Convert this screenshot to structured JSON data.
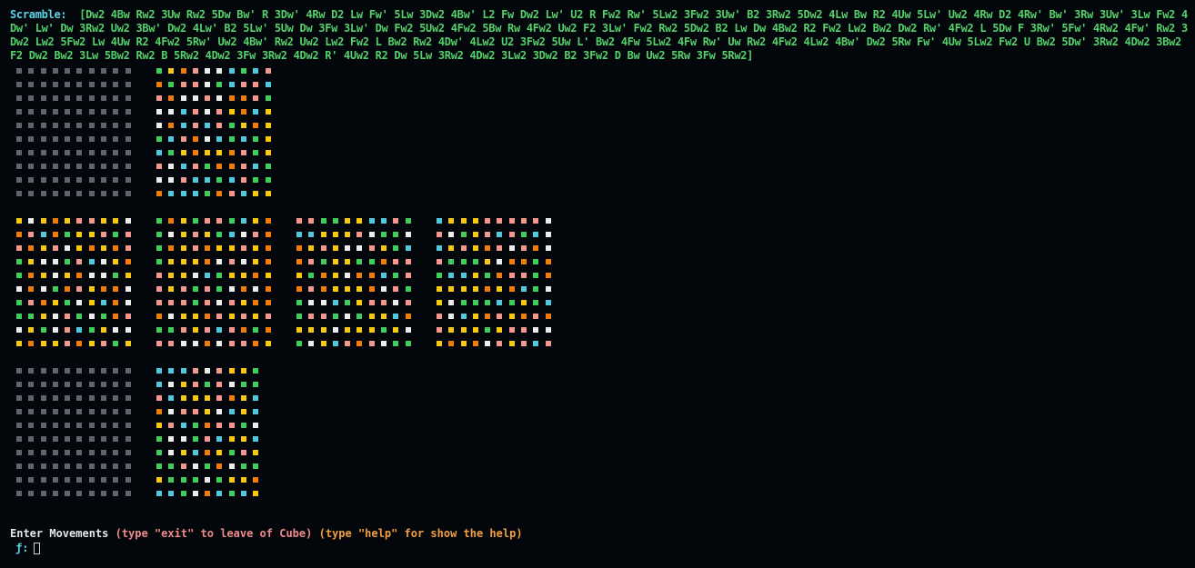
{
  "scramble": {
    "label": "Scramble:",
    "moves": "[Dw2 4Bw Rw2 3Uw Rw2 5Dw Bw' R 3Dw' 4Rw D2 Lw Fw' 5Lw 3Dw2 4Bw' L2 Fw Dw2 Lw' U2 R Fw2 Rw' 5Lw2 3Fw2 3Uw' B2 3Rw2 5Dw2 4Lw Bw R2 4Uw 5Lw' Uw2 4Rw D2 4Rw' Bw' 3Rw 3Uw' 3Lw Fw2 4Dw' Lw' Dw 3Rw2 Uw2 3Bw' Dw2 4Lw' B2 5Lw' 5Uw Dw 3Fw 3Lw' Dw Fw2 5Uw2 4Fw2 5Bw Rw 4Fw2 Uw2 F2 3Lw' Fw2 Rw2 5Dw2 B2 Lw Dw 4Bw2 R2 Fw2 Lw2 Bw2 Dw2 Rw' 4Fw2 L 5Dw F 3Rw' 5Fw' 4Rw2 4Fw' Rw2 3Dw2 Lw2 5Fw2 Lw 4Uw R2 4Fw2 5Rw' Uw2 4Bw' Rw2 Uw2 Lw2 Fw2 L Bw2 Rw2 4Dw' 4Lw2 U2 3Fw2 5Uw L' Bw2 4Fw 5Lw2 4Fw Rw' Uw Rw2 4Fw2 4Lw2 4Bw' Dw2 5Rw Fw' 4Uw 5Lw2 Fw2 U Bw2 5Dw' 3Rw2 4Dw2 3Bw2 F2 Dw2 Bw2 3Lw 5Bw2 Rw2 B 5Rw2 4Dw2 3Fw 3Rw2 4Dw2 R' 4Uw2 R2 Dw 5Lw 3Rw2 4Dw2 3Lw2 3Dw2 B2 3Fw2 D Bw Uw2 5Rw 3Fw 5Rw2]"
  },
  "colors": {
    "w": "#ececec",
    "y": "#f6c90e",
    "o": "#f07d0a",
    "r": "#f4978e",
    "g": "#3fcd5c",
    "b": "#52c8dc",
    "x": "#5f646d"
  },
  "faces": [
    {
      "name": "blank-top-left",
      "rows": [
        "xxxxxxxxxx",
        "xxxxxxxxxx",
        "xxxxxxxxxx",
        "xxxxxxxxxx",
        "xxxxxxxxxx",
        "xxxxxxxxxx",
        "xxxxxxxxxx",
        "xxxxxxxxxx",
        "xxxxxxxxxx",
        "xxxxxxxxxx"
      ]
    },
    {
      "name": "up",
      "rows": [
        "gyorwwbgbr",
        "ogrrwgbrrb",
        "rowwrwoorg",
        "wwbrwryoby",
        "wobrbrgyoy",
        "gbrowbgbgy",
        "bgyoyyorgy",
        "rwbrgoorbg",
        "wwrbbgbrgg",
        "obbbgorbyy"
      ]
    },
    {
      "name": "left",
      "rows": [
        "ywyoyrryyw",
        "orbogyyrgr",
        "royrwyoyor",
        "gywwgrbwyo",
        "goywyowwgy",
        "wowgoryoow",
        "groygwybow",
        "ggywrgwgor",
        "wygwrbgyww",
        "yoyyroyrgy"
      ]
    },
    {
      "name": "front",
      "rows": [
        "goygrrgbyo",
        "gwyrygbwro",
        "goyroyyryo",
        "gyyyowrwyo",
        "ryywbgyyoy",
        "ryrgrgwowo",
        "rrrgrwryoo",
        "owyyoryryr",
        "ggryrbrogo",
        "rrwwowrroy"
      ]
    },
    {
      "name": "right",
      "rows": [
        "rrggyybbrg",
        "bbyyyrwggw",
        "oyrywwrygb",
        "orgyyggorr",
        "ygoywoobgr",
        "oroyyyowrg",
        "gwwbgyrrwr",
        "grrgwgyybo",
        "yyywyyygyw",
        "gwybrorwgg"
      ]
    },
    {
      "name": "back",
      "rows": [
        "byyyrrrrrw",
        "rwgyrbrgbw",
        "byryorwrow",
        "rgggywoogo",
        "gbbygorrgo",
        "yyyyoyobgw",
        "ywgggbgygb",
        "rwbyoryoro",
        "ryyygyrrww",
        "yoyowryrbr"
      ]
    },
    {
      "name": "blank-bottom-left",
      "rows": [
        "xxxxxxxxxx",
        "xxxxxxxxxx",
        "xxxxxxxxxx",
        "xxxxxxxxxx",
        "xxxxxxxxxx",
        "xxxxxxxxxx",
        "xxxxxxxxxx",
        "xxxxxxxxxx",
        "xxxxxxxxxx",
        "xxxxxxxxxx"
      ]
    },
    {
      "name": "down",
      "rows": [
        "bbbrwryyg",
        "bwyrgrwgg",
        "rbyyyroyb",
        "owrrywbyb",
        "yrbgorrgw",
        "gwwgrbyyb",
        "gwyboygry",
        "ggrwgowgg",
        "ygggwgyyo",
        "bbgwobgby"
      ]
    }
  ],
  "prompt": {
    "enter": "Enter Movements",
    "exit_hint": "(type \"exit\" to leave of Cube)",
    "help_hint": "(type \"help\" for show the help)",
    "symbol": "ƒ:"
  }
}
